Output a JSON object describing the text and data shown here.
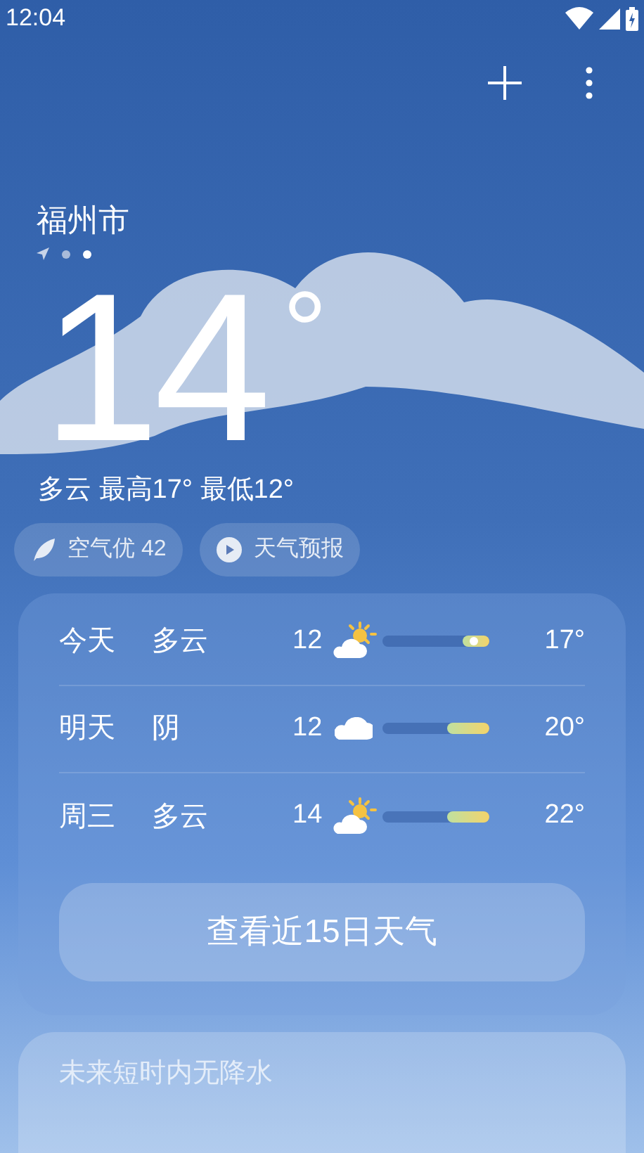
{
  "status_bar": {
    "time": "12:04"
  },
  "city": {
    "name": "福州市",
    "pages": [
      {
        "kind": "location",
        "selected": false
      },
      {
        "kind": "dot",
        "selected": false
      },
      {
        "kind": "dot",
        "selected": true
      }
    ]
  },
  "current": {
    "temperature": "14",
    "unit": "°",
    "summary": "多云 最高17° 最低12°"
  },
  "chips": [
    {
      "kind": "leaf",
      "label": "空气优 42"
    },
    {
      "kind": "play",
      "label": "天气预报"
    }
  ],
  "forecast": [
    {
      "day": "今天",
      "condition": "多云",
      "kind": "partly-cloudy",
      "low": "12",
      "high": "17°",
      "level": 0.25,
      "now": true
    },
    {
      "day": "明天",
      "condition": "阴",
      "kind": "cloudy",
      "low": "12",
      "high": "20°",
      "level": 0.4,
      "now": false
    },
    {
      "day": "周三",
      "condition": "多云",
      "kind": "partly-cloudy",
      "low": "14",
      "high": "22°",
      "level": 0.4,
      "now": false
    }
  ],
  "more_button": "查看近15日天气",
  "precipitation": "未来短时内无降水"
}
